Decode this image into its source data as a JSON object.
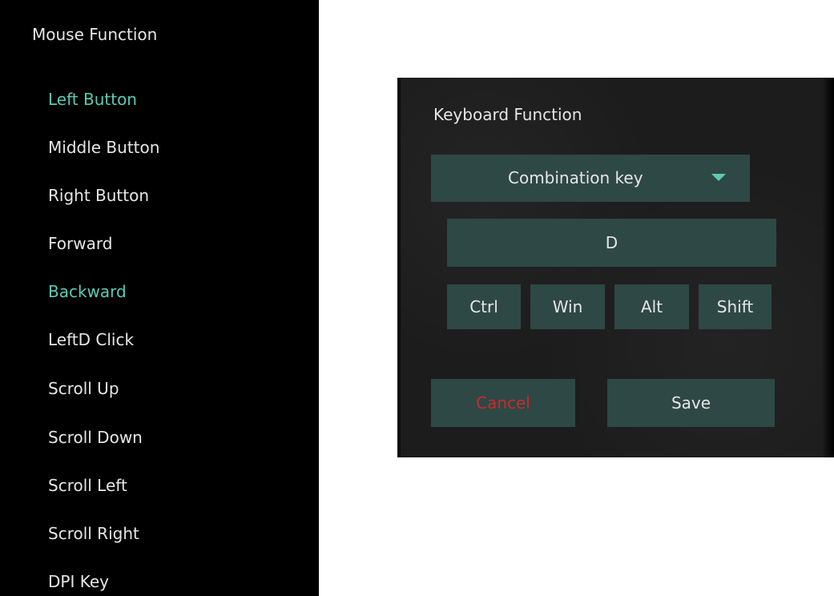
{
  "mouse_function": {
    "title": "Mouse Function",
    "accent_color": "#5ecab5",
    "items": [
      {
        "label": "Left Button",
        "highlighted": true
      },
      {
        "label": "Middle Button",
        "highlighted": false
      },
      {
        "label": "Right Button",
        "highlighted": false
      },
      {
        "label": "Forward",
        "highlighted": false
      },
      {
        "label": "Backward",
        "highlighted": true
      },
      {
        "label": "LeftD Click",
        "highlighted": false
      },
      {
        "label": "Scroll Up",
        "highlighted": false
      },
      {
        "label": "Scroll Down",
        "highlighted": false
      },
      {
        "label": "Scroll Left",
        "highlighted": false
      },
      {
        "label": "Scroll Right",
        "highlighted": false
      },
      {
        "label": "DPI Key",
        "highlighted": false
      }
    ]
  },
  "keyboard_function": {
    "title": "Keyboard Function",
    "mode_select": {
      "value": "Combination key",
      "icon": "caret-down-icon"
    },
    "key_value": "D",
    "modifiers": [
      "Ctrl",
      "Win",
      "Alt",
      "Shift"
    ],
    "cancel_label": "Cancel",
    "save_label": "Save",
    "button_color": "#2e4845",
    "cancel_text_color": "#cc2a2a"
  }
}
